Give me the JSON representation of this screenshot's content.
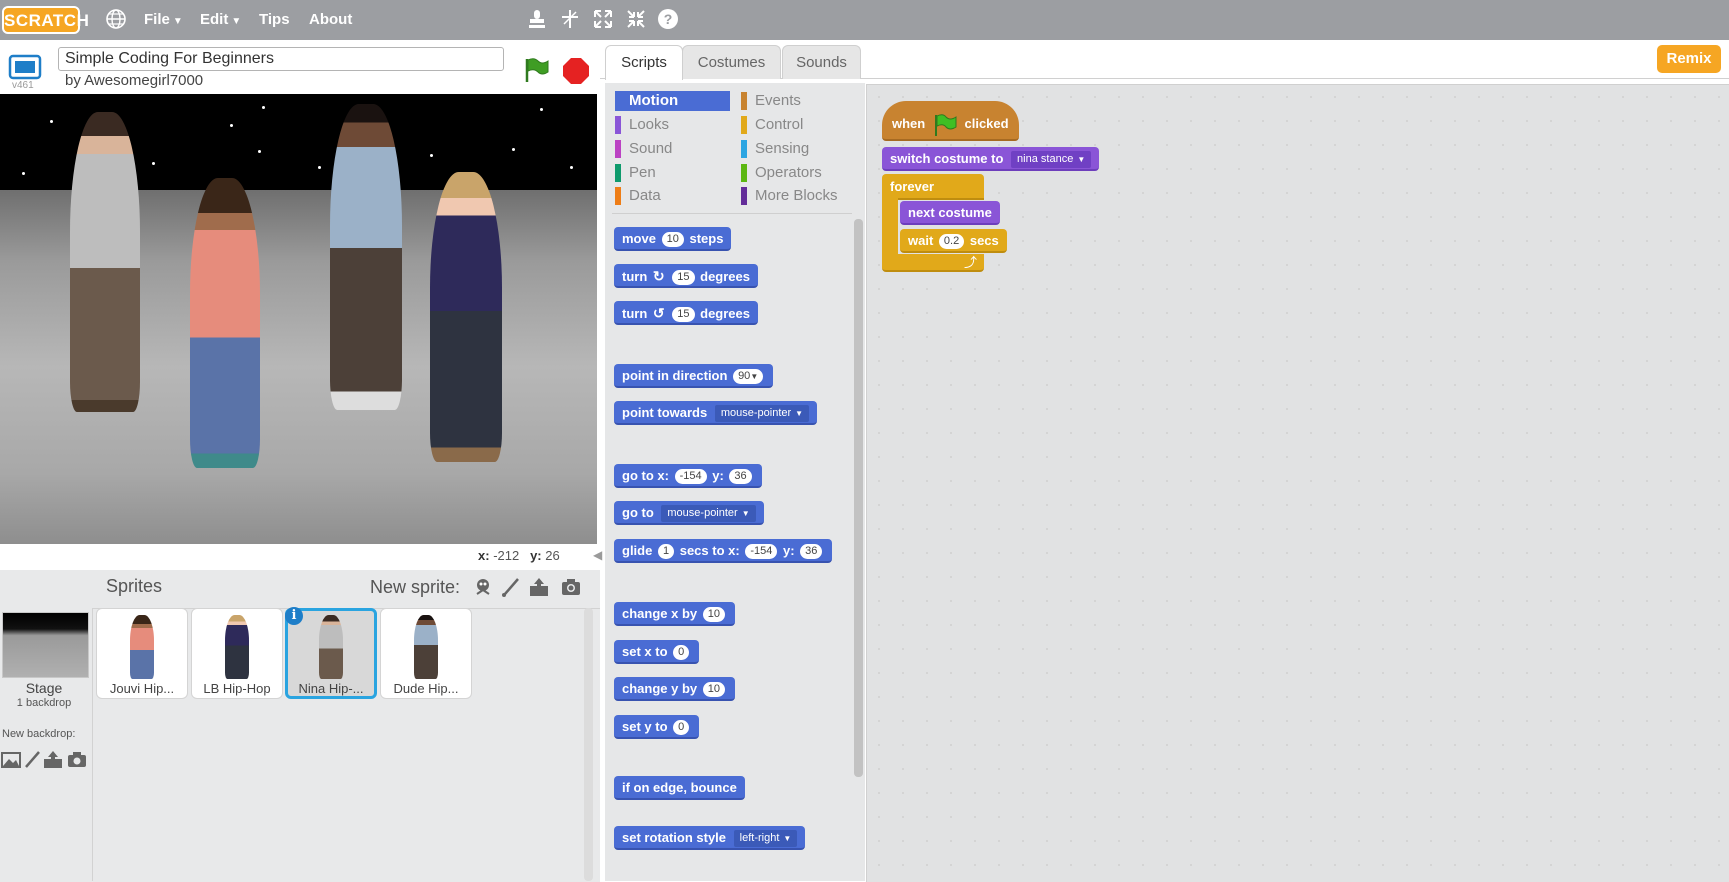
{
  "topbar": {
    "logo_text": "SCRATCH",
    "menus": [
      {
        "label": "File",
        "has_caret": true
      },
      {
        "label": "Edit",
        "has_caret": true
      },
      {
        "label": "Tips",
        "has_caret": false
      },
      {
        "label": "About",
        "has_caret": false
      }
    ],
    "icons": [
      "globe-icon",
      "duplicate-stamp-icon",
      "delete-cut-icon",
      "grow-icon",
      "shrink-icon",
      "help-icon"
    ]
  },
  "stage": {
    "project_title": "Simple Coding For Beginners",
    "author_line": "by Awesomegirl7000",
    "version": "v461",
    "mouse_x_label": "x:",
    "mouse_x": "-212",
    "mouse_y_label": "y:",
    "mouse_y": "26"
  },
  "sprites_panel": {
    "title": "Sprites",
    "new_sprite_label": "New sprite:",
    "stage_label": "Stage",
    "backdrop_count": "1 backdrop",
    "new_backdrop_label": "New backdrop:",
    "sprites": [
      {
        "name": "Jouvi Hip...",
        "selected": false
      },
      {
        "name": "LB Hip-Hop",
        "selected": false
      },
      {
        "name": "Nina Hip-...",
        "selected": true
      },
      {
        "name": "Dude Hip...",
        "selected": false
      }
    ]
  },
  "tabs": [
    {
      "label": "Scripts",
      "active": true
    },
    {
      "label": "Costumes",
      "active": false
    },
    {
      "label": "Sounds",
      "active": false
    }
  ],
  "remix_label": "Remix",
  "categories": {
    "left": [
      {
        "label": "Motion",
        "color": "#4a6cd4",
        "active": true
      },
      {
        "label": "Looks",
        "color": "#8a55d7",
        "active": false
      },
      {
        "label": "Sound",
        "color": "#bb42c3",
        "active": false
      },
      {
        "label": "Pen",
        "color": "#0e9a6c",
        "active": false
      },
      {
        "label": "Data",
        "color": "#ee7d16",
        "active": false
      }
    ],
    "right": [
      {
        "label": "Events",
        "color": "#c88330",
        "active": false
      },
      {
        "label": "Control",
        "color": "#e1a91a",
        "active": false
      },
      {
        "label": "Sensing",
        "color": "#2ca5e2",
        "active": false
      },
      {
        "label": "Operators",
        "color": "#5cb712",
        "active": false
      },
      {
        "label": "More Blocks",
        "color": "#632d99",
        "active": false
      }
    ]
  },
  "palette_blocks": {
    "move": {
      "a": "move",
      "n": "10",
      "b": "steps"
    },
    "turn_cw": {
      "a": "turn",
      "n": "15",
      "b": "degrees"
    },
    "turn_ccw": {
      "a": "turn",
      "n": "15",
      "b": "degrees"
    },
    "point_dir": {
      "a": "point in direction",
      "n": "90"
    },
    "point_towards": {
      "a": "point towards",
      "d": "mouse-pointer"
    },
    "goto_xy": {
      "a": "go to x:",
      "x": "-154",
      "b": "y:",
      "y": "36"
    },
    "goto": {
      "a": "go to",
      "d": "mouse-pointer"
    },
    "glide": {
      "a": "glide",
      "n": "1",
      "b": "secs to x:",
      "x": "-154",
      "c": "y:",
      "y": "36"
    },
    "change_x": {
      "a": "change x by",
      "n": "10"
    },
    "set_x": {
      "a": "set x to",
      "n": "0"
    },
    "change_y": {
      "a": "change y by",
      "n": "10"
    },
    "set_y": {
      "a": "set y to",
      "n": "0"
    },
    "bounce": {
      "a": "if on edge, bounce"
    },
    "rotation": {
      "a": "set rotation style",
      "d": "left-right"
    }
  },
  "script": {
    "hat": {
      "a": "when",
      "b": "clicked"
    },
    "switch": {
      "a": "switch costume to",
      "d": "nina stance"
    },
    "forever": "forever",
    "next": "next costume",
    "wait": {
      "a": "wait",
      "n": "0.2",
      "b": "secs"
    }
  }
}
